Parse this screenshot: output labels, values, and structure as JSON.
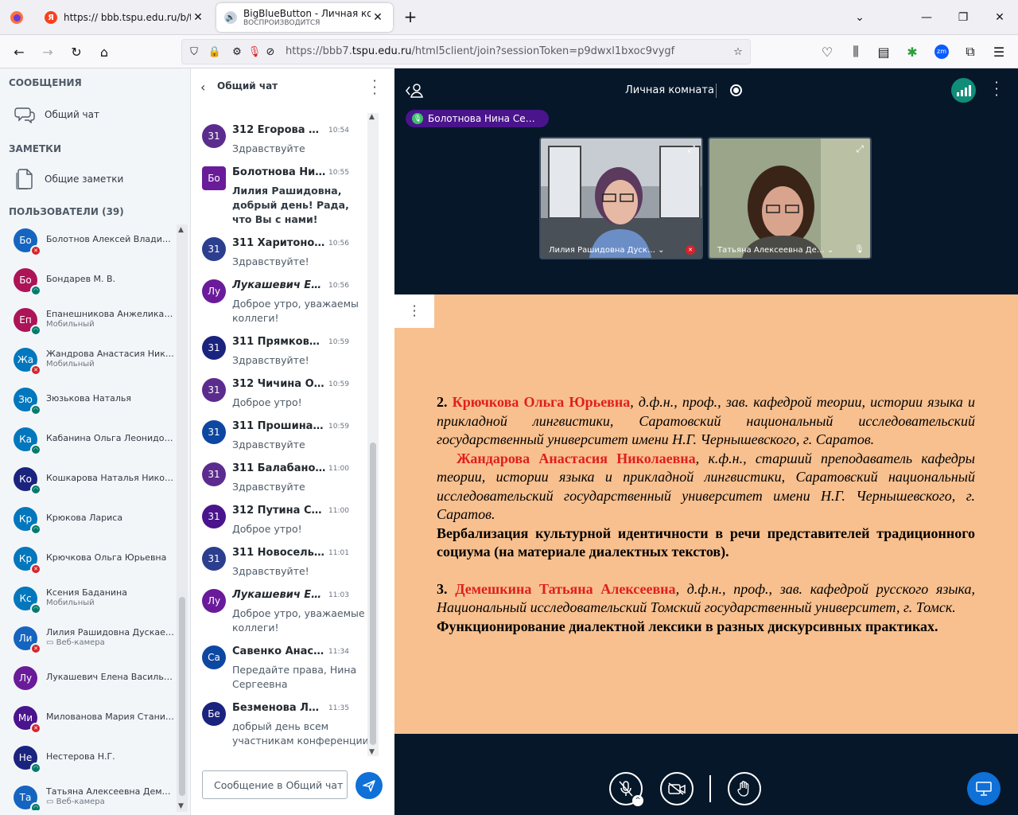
{
  "browser": {
    "tab1_title": "https:// bbb.tspu.edu.ru/b/tmf",
    "tab2_title": "BigBlueButton - Личная комната",
    "tab2_sub": "ВОСПРОИЗВОДИТСЯ",
    "url_prefix": "https://bbb7.",
    "url_domain": "tspu.edu.ru",
    "url_rest": "/html5client/join?sessionToken=p9dwxl1bxoc9vygf",
    "zoom_badge": "zm"
  },
  "sidebar": {
    "messages_header": "СООБЩЕНИЯ",
    "public_chat": "Общий чат",
    "notes_header": "ЗАМЕТКИ",
    "shared_notes": "Общие заметки",
    "users_header": "ПОЛЬЗОВАТЕЛИ (39)"
  },
  "users": [
    {
      "initials": "Бо",
      "name": "Болотнов Алексей Владимиро…",
      "sub": "",
      "color": "#1565c0",
      "status": "muted"
    },
    {
      "initials": "Бо",
      "name": "Бондарев М. В.",
      "sub": "",
      "color": "#ad1457",
      "status": "listen"
    },
    {
      "initials": "Еп",
      "name": "Епанешникова Анжелика Пав…",
      "sub": "Мобильный",
      "color": "#ad1457",
      "status": "listen"
    },
    {
      "initials": "Жа",
      "name": "Жандрова Анастасия Николае…",
      "sub": "Мобильный",
      "color": "#0277bd",
      "status": "muted"
    },
    {
      "initials": "Зю",
      "name": "Зюзькова Наталья",
      "sub": "",
      "color": "#0277bd",
      "status": "listen"
    },
    {
      "initials": "Ка",
      "name": "Кабанина Ольга Леонидовна",
      "sub": "",
      "color": "#0277bd",
      "status": "listen"
    },
    {
      "initials": "Ко",
      "name": "Кошкарова Наталья Николаев…",
      "sub": "",
      "color": "#1a237e",
      "status": "listen"
    },
    {
      "initials": "Кр",
      "name": "Крюкова Лариса",
      "sub": "",
      "color": "#0277bd",
      "status": "listen"
    },
    {
      "initials": "Кр",
      "name": "Крючкова Ольга Юрьевна",
      "sub": "",
      "color": "#0277bd",
      "status": "muted"
    },
    {
      "initials": "Кс",
      "name": "Ксения Баданина",
      "sub": "Мобильный",
      "color": "#0277bd",
      "status": "listen"
    },
    {
      "initials": "Ли",
      "name": "Лилия Рашидовна Дускаева",
      "sub": "Веб-камера",
      "color": "#1565c0",
      "status": "muted"
    },
    {
      "initials": "Лу",
      "name": "Лукашевич Елена Васильевна",
      "sub": "",
      "color": "#6a1b9a",
      "status": "none"
    },
    {
      "initials": "Ми",
      "name": "Милованова Мария Станисла…",
      "sub": "",
      "color": "#4a148c",
      "status": "muted"
    },
    {
      "initials": "Не",
      "name": "Нестерова Н.Г.",
      "sub": "",
      "color": "#1a237e",
      "status": "listen"
    },
    {
      "initials": "Та",
      "name": "Татьяна Алексеевна Демешки…",
      "sub": "Веб-камера",
      "color": "#1565c0",
      "status": "listen"
    }
  ],
  "chat": {
    "title": "Общий чат",
    "placeholder": "Сообщение в Общий чат",
    "messages": [
      {
        "initials": "31",
        "name": "312 Егорова П…",
        "time": "10:54",
        "text": "Здравствуйте",
        "color": "#5b2c8e",
        "bold": false
      },
      {
        "initials": "Бо",
        "name": "Болотнова Ни…",
        "time": "10:55",
        "text": "Лилия Рашидовна, добрый день! Рада, что Вы с нами!",
        "color": "#6a1b9a",
        "bold": true
      },
      {
        "initials": "31",
        "name": "311 Харитонов…",
        "time": "10:56",
        "text": "Здравствуйте!",
        "color": "#2c3e8e",
        "bold": false
      },
      {
        "initials": "Лу",
        "name": "Лукашевич Ел…",
        "time": "10:56",
        "text": "Доброе утро, уважаемы коллеги!",
        "color": "#6a1b9a",
        "bold": false
      },
      {
        "initials": "31",
        "name": "311 Прямкова …",
        "time": "10:59",
        "text": "Здравствуйте!",
        "color": "#1a237e",
        "bold": false
      },
      {
        "initials": "31",
        "name": "312 Чичина Ол…",
        "time": "10:59",
        "text": "Доброе утро!",
        "color": "#5b2c8e",
        "bold": false
      },
      {
        "initials": "31",
        "name": "311 Прошина …",
        "time": "10:59",
        "text": "Здравствуйте",
        "color": "#0d47a1",
        "bold": false
      },
      {
        "initials": "31",
        "name": "311 Балабано…",
        "time": "11:00",
        "text": "Здравствуйте",
        "color": "#5b2c8e",
        "bold": false
      },
      {
        "initials": "31",
        "name": "312 Путина Со…",
        "time": "11:00",
        "text": "Доброе утро!",
        "color": "#4a148c",
        "bold": false
      },
      {
        "initials": "31",
        "name": "311 Новосель…",
        "time": "11:01",
        "text": "Здравствуйте!",
        "color": "#2c3e8e",
        "bold": false
      },
      {
        "initials": "Лу",
        "name": "Лукашевич Ел…",
        "time": "11:03",
        "text": "Доброе утро, уважаемые коллеги!",
        "color": "#6a1b9a",
        "bold": false
      },
      {
        "initials": "Са",
        "name": "Савенко Анас…",
        "time": "11:34",
        "text": "Передайте права, Нина Сергеевна",
        "color": "#0d47a1",
        "bold": false
      },
      {
        "initials": "Бе",
        "name": "Безменова Л…",
        "time": "11:35",
        "text": "добрый день всем участникам конференции",
        "color": "#1a237e",
        "bold": false
      }
    ]
  },
  "room": {
    "title": "Личная комната",
    "talking": "Болотнова Нина Се…",
    "video1_label": "Лилия Рашидовна Дуск…",
    "video2_label": "Татьяна Алексеевна Де…"
  },
  "slide": {
    "p1_num": "2.",
    "p1_name": "Крючкова Ольга Юрьевна",
    "p1_desc": ", д.ф.н., проф., зав. кафедрой теории, истории языка и прикладной лингвистики, Саратовский национальный исследовательский государственный университет имени Н.Г. Чернышевского, г. Саратов.",
    "p2_name": "Жандарова Анастасия Николаевна",
    "p2_desc": ", к.ф.н., старший преподаватель кафедры теории, истории языка и прикладной лингвистики, Саратовский национальный исследовательский государственный университет имени Н.Г. Чернышевского, г. Саратов.",
    "p3_title": "Вербализация культурной идентичности в речи представителей традиционного социума (на материале диалектных текстов).",
    "p4_num": "3.",
    "p4_name": "Демешкина Татьяна Алексеевна",
    "p4_desc": ", д.ф.н., проф., зав. кафедрой русского языка, Национальный исследовательский Томский государственный университет, г. Томск.",
    "p5_title": "Функционирование диалектной лексики в разных дискурсивных практиках."
  },
  "colors": {
    "accent": "#0f70d7",
    "slide_bg": "#f8c08f",
    "stage_bg": "#06172a",
    "muted_badge": "#d6232a",
    "listen_badge": "#00796b",
    "connection_ok": "#0f8d78"
  }
}
